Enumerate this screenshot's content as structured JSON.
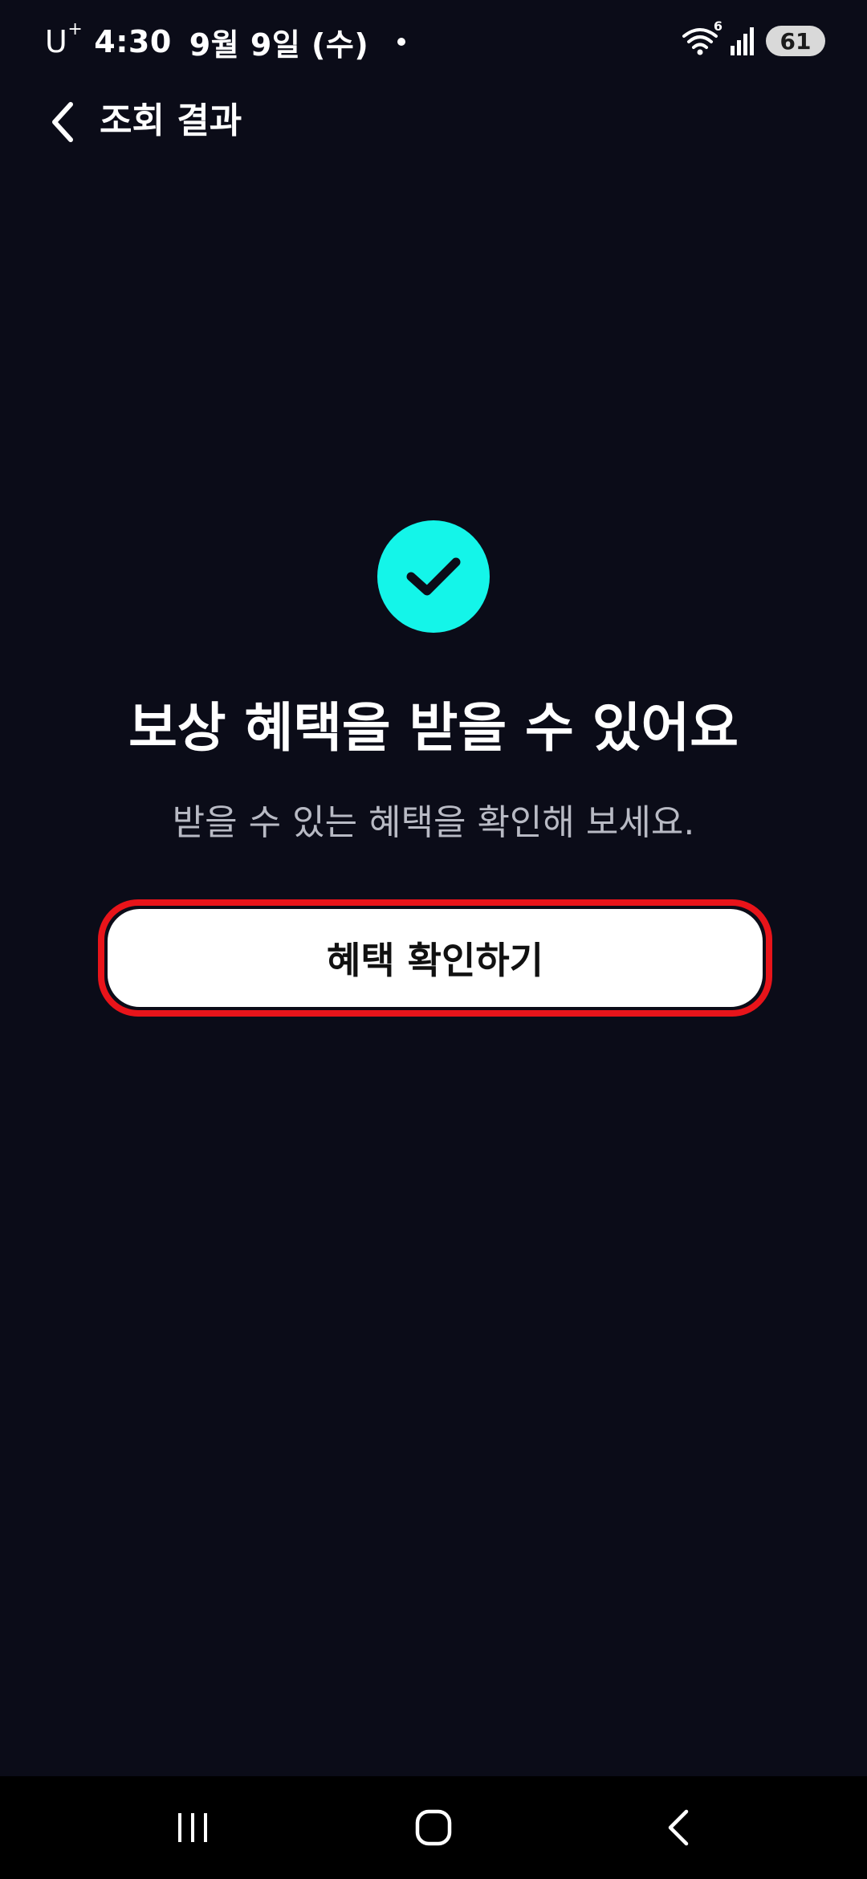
{
  "status_bar": {
    "carrier": "U",
    "carrier_sup": "+",
    "time": "4:30",
    "date": "9월 9일 (수)",
    "battery": "61",
    "wifi_badge": "6"
  },
  "header": {
    "title": "조회 결과"
  },
  "main": {
    "title": "보상 혜택을 받을 수 있어요",
    "subtitle": "받을 수 있는 혜택을 확인해 보세요.",
    "cta_label": "혜택 확인하기"
  },
  "colors": {
    "background": "#0b0c18",
    "accent_check": "#14f5e9",
    "highlight_border": "#e8141a",
    "button_bg": "#ffffff"
  },
  "icons": {
    "back": "chevron-left-icon",
    "check": "check-icon",
    "wifi": "wifi-icon",
    "signal": "signal-icon",
    "nav_recents": "recents-icon",
    "nav_home": "home-icon",
    "nav_back": "back-icon"
  }
}
